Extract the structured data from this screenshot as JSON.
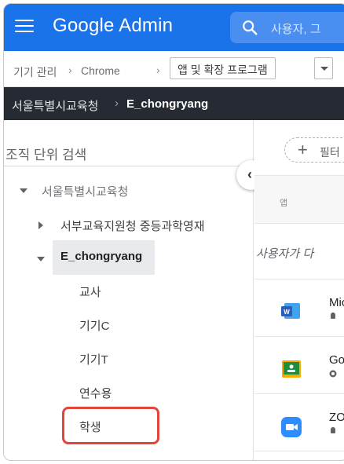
{
  "header": {
    "app_title": "Google Admin",
    "search_placeholder": "사용자, 그"
  },
  "breadcrumb": {
    "items": [
      "기기 관리",
      "Chrome"
    ],
    "separator": "›",
    "current": "앱 및 확장 프로그램"
  },
  "org_path": {
    "root": "서울특별시교육청",
    "separator": "›",
    "current": "E_chongryang"
  },
  "left_panel": {
    "heading": "조직 단위 검색",
    "root_unit": "서울특별시교육청",
    "child_unit": "서부교육지원청 중등과학영재",
    "selected_unit": "E_chongryang",
    "sub_units": [
      "교사",
      "기기C",
      "기기T",
      "연수용",
      "학생"
    ]
  },
  "collapse_button": {
    "glyph": "‹"
  },
  "right_panel": {
    "filter_label": "필터",
    "column_header": "앱",
    "user_note": "사용자가 다",
    "apps": [
      {
        "name": "Mic",
        "icon": "word-icon",
        "color": "#2b5eb7",
        "sub_icon": "android-icon"
      },
      {
        "name": "Goo",
        "icon": "classroom-icon",
        "color": "#1e8e3e",
        "sub_icon": "google-icon"
      },
      {
        "name": "ZOC",
        "icon": "zoom-icon",
        "color": "#2d8cff",
        "sub_icon": "android-icon"
      }
    ]
  },
  "colors": {
    "header_bg": "#1a73e8",
    "org_bar_bg": "#262b33",
    "highlight": "#e0463a"
  }
}
